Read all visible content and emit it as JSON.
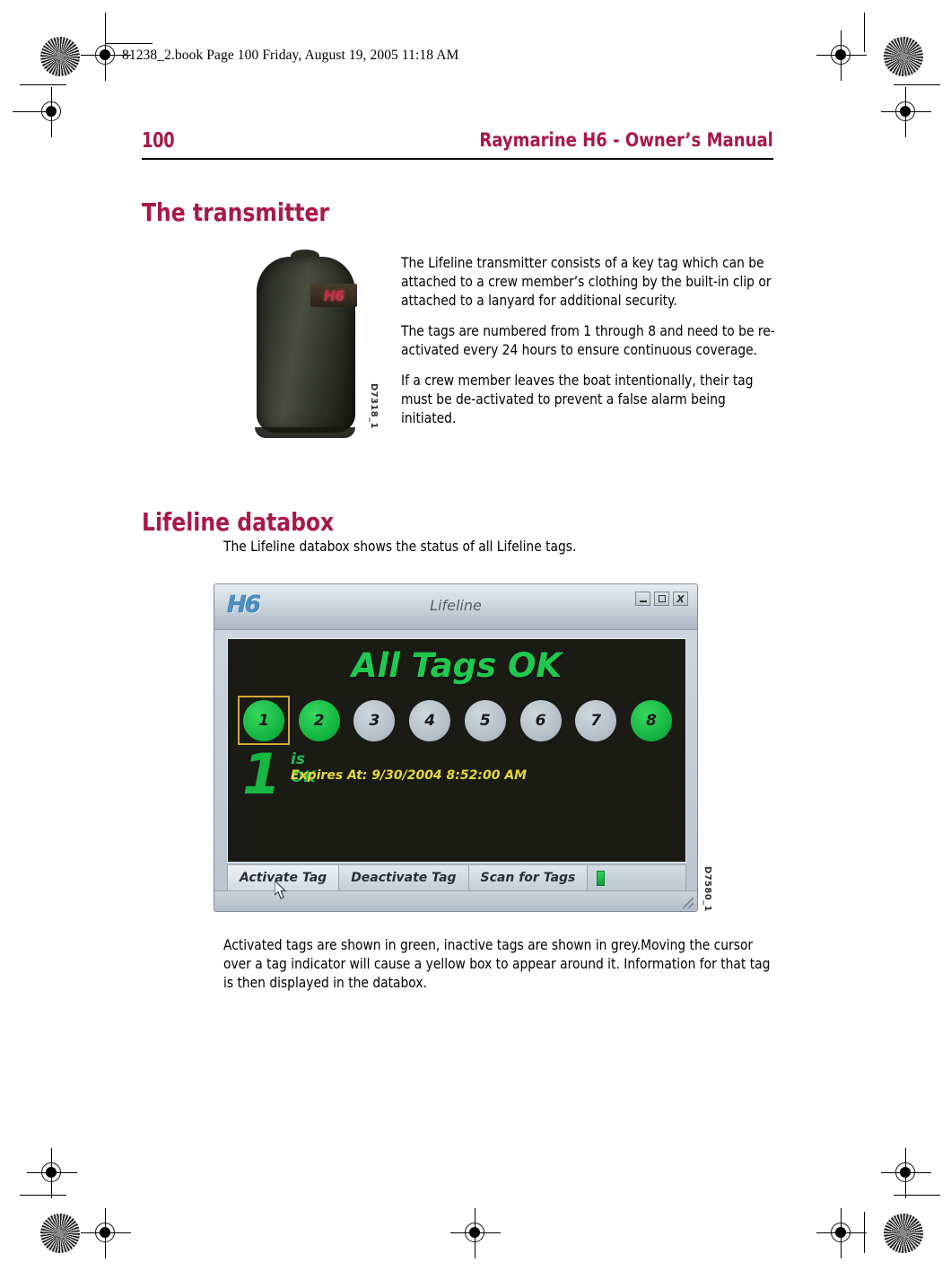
{
  "print_slug": "81238_2.book  Page 100  Friday, August 19, 2005  11:18 AM",
  "running_head": {
    "folio": "100",
    "manual_title": "Raymarine H6 - Owner’s Manual"
  },
  "colors": {
    "accent": "#a9184b",
    "tag_active": "#16b843",
    "tag_inactive": "#b3bfc6",
    "selection_box": "#d2a83a",
    "status_ok": "#27b85a",
    "expires_text": "#e4d83a",
    "screen_bg": "#1b1b16",
    "h6_logo": "#4d8fc4"
  },
  "sections": [
    {
      "heading": "The transmitter",
      "paragraphs": [
        "The Lifeline transmitter consists of a key tag which can be attached to a crew member’s clothing by the built-in clip or attached to a lanyard for additional security.",
        "The tags are numbered from 1 through 8 and need to be re-activated every 24 hours to ensure continuous coverage.",
        "If a crew member leaves the boat intentionally, their tag must be de-activated to prevent a false alarm being initiated."
      ],
      "figure_caption": "D7318_1",
      "figure_logo": "H6"
    },
    {
      "heading": "Lifeline databox",
      "lead_paragraph": "The Lifeline databox shows the status of all Lifeline tags.",
      "closing_paragraph": "Activated tags are shown in green, inactive tags are shown in grey.Moving the cursor over a tag indicator will cause a yellow box to appear around it. Information for that tag is then displayed in the databox.",
      "figure_caption": "D7580_1"
    }
  ],
  "databox": {
    "brand_logo": "H6",
    "window_title": "Lifeline",
    "window_buttons": [
      {
        "name": "minimize",
        "glyph": "–"
      },
      {
        "name": "maximize",
        "glyph": "□"
      },
      {
        "name": "close",
        "glyph": "X"
      }
    ],
    "status_banner": "All Tags OK",
    "tags": [
      {
        "number": "1",
        "state": "active",
        "selected": true
      },
      {
        "number": "2",
        "state": "active",
        "selected": false
      },
      {
        "number": "3",
        "state": "inactive",
        "selected": false
      },
      {
        "number": "4",
        "state": "inactive",
        "selected": false
      },
      {
        "number": "5",
        "state": "inactive",
        "selected": false
      },
      {
        "number": "6",
        "state": "inactive",
        "selected": false
      },
      {
        "number": "7",
        "state": "inactive",
        "selected": false
      },
      {
        "number": "8",
        "state": "active",
        "selected": false
      }
    ],
    "detail": {
      "tag_number": "1",
      "status": "is OK",
      "expires": "Expires At: 9/30/2004 8:52:00 AM"
    },
    "toolbar": {
      "buttons": [
        {
          "label": "Activate Tag",
          "pressed": true
        },
        {
          "label": "Deactivate Tag",
          "pressed": false
        },
        {
          "label": "Scan for Tags",
          "pressed": false
        }
      ],
      "indicator": "scan-active-indicator"
    }
  }
}
